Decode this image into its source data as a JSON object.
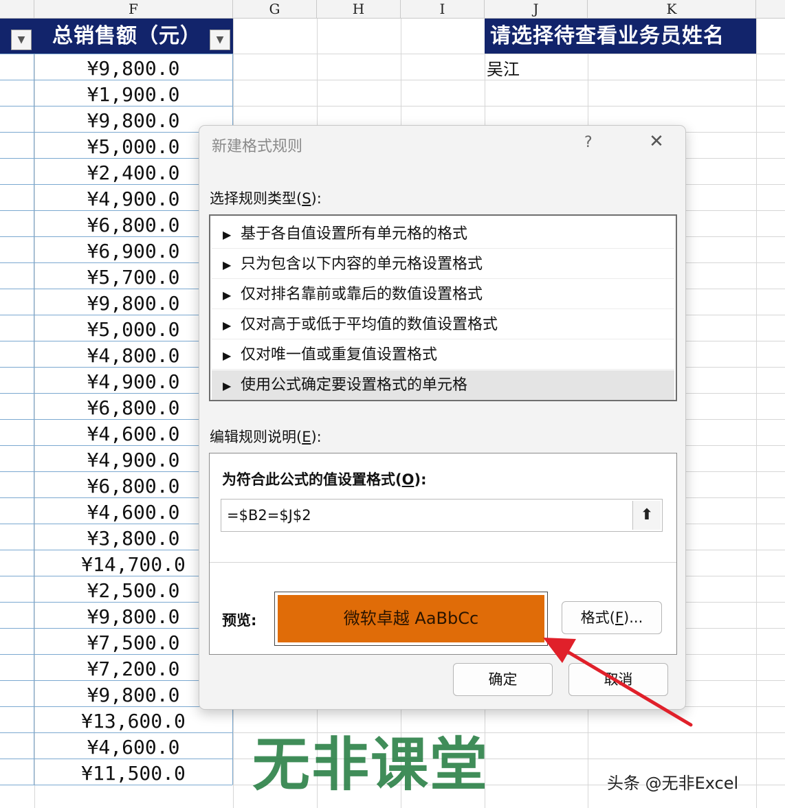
{
  "sheet": {
    "columns": [
      "F",
      "G",
      "H",
      "I",
      "J",
      "K"
    ],
    "table_header": {
      "total_sales_label": "总销售额（元）",
      "filter_glyph": "▼"
    },
    "lookup": {
      "header": "请选择待查看业务员姓名",
      "value": "吴江"
    },
    "total_sales": [
      "¥9,800.0",
      "¥1,900.0",
      "¥9,800.0",
      "¥5,000.0",
      "¥2,400.0",
      "¥4,900.0",
      "¥6,800.0",
      "¥6,900.0",
      "¥5,700.0",
      "¥9,800.0",
      "¥5,000.0",
      "¥4,800.0",
      "¥4,900.0",
      "¥6,800.0",
      "¥4,600.0",
      "¥4,900.0",
      "¥6,800.0",
      "¥4,600.0",
      "¥3,800.0",
      "¥14,700.0",
      "¥2,500.0",
      "¥9,800.0",
      "¥7,500.0",
      "¥7,200.0",
      "¥9,800.0",
      "¥13,600.0",
      "¥4,600.0",
      "¥11,500.0"
    ]
  },
  "dialog": {
    "title": "新建格式规则",
    "help": "?",
    "close": "✕",
    "rule_type_label": "选择规则类型(",
    "rule_type_key": "S",
    "rule_type_suffix": "):",
    "rule_types": [
      "基于各自值设置所有单元格的格式",
      "只为包含以下内容的单元格设置格式",
      "仅对排名靠前或靠后的数值设置格式",
      "仅对高于或低于平均值的数值设置格式",
      "仅对唯一值或重复值设置格式",
      "使用公式确定要设置格式的单元格"
    ],
    "arrow": "▶",
    "edit_label": "编辑规则说明(",
    "edit_key": "E",
    "edit_suffix": "):",
    "formula_label": "为符合此公式的值设置格式(",
    "formula_key": "O",
    "formula_suffix": "):",
    "formula_value": "=$B2=$J$2",
    "collapse_icon": "⬆",
    "preview_label": "预览:",
    "preview_text": "微软卓越  AaBbCc",
    "preview_color": "#e06c08",
    "format_button_prefix": "格式(",
    "format_button_key": "F",
    "format_button_suffix": ")...",
    "ok_button": "确定",
    "cancel_button": "取消"
  },
  "watermark": "无非课堂",
  "footer": "头条 @无非Excel",
  "colors": {
    "header_fill": "#12246b",
    "annotation_arrow": "#e0202a",
    "watermark": "#1f7a3d"
  }
}
